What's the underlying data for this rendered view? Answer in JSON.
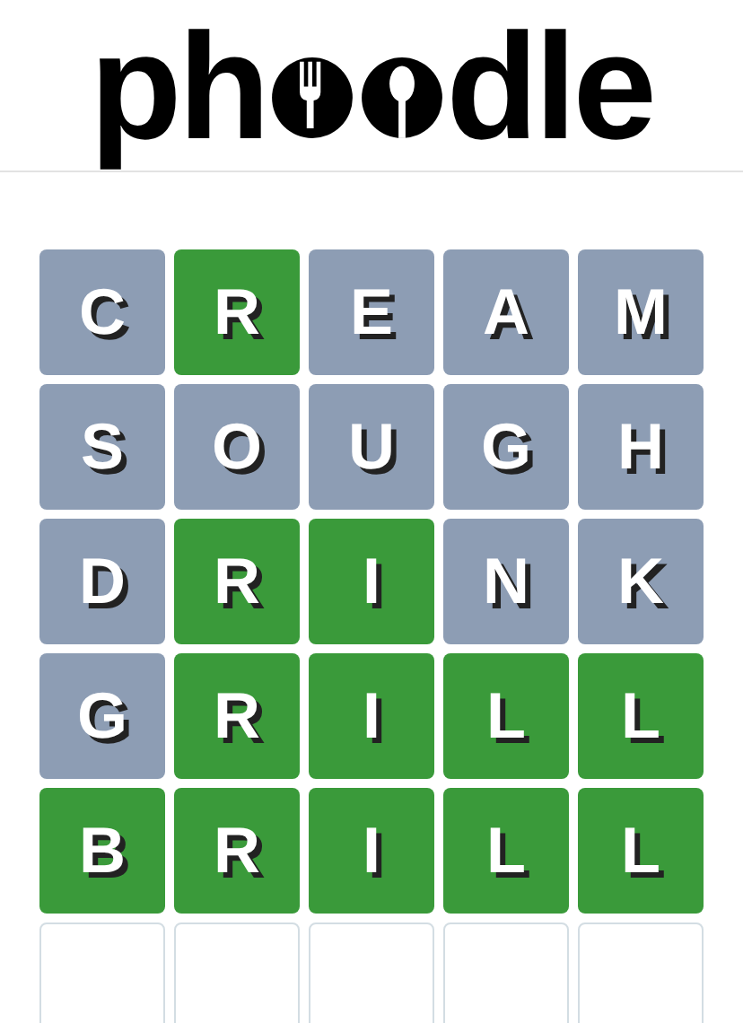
{
  "logo": {
    "text_before": "ph",
    "text_after": "dle"
  },
  "board": {
    "rows": [
      {
        "tiles": [
          {
            "letter": "C",
            "kind": "absent"
          },
          {
            "letter": "R",
            "kind": "correct"
          },
          {
            "letter": "E",
            "kind": "absent"
          },
          {
            "letter": "A",
            "kind": "absent"
          },
          {
            "letter": "M",
            "kind": "absent"
          }
        ]
      },
      {
        "tiles": [
          {
            "letter": "S",
            "kind": "absent"
          },
          {
            "letter": "O",
            "kind": "absent"
          },
          {
            "letter": "U",
            "kind": "absent"
          },
          {
            "letter": "G",
            "kind": "absent"
          },
          {
            "letter": "H",
            "kind": "absent"
          }
        ]
      },
      {
        "tiles": [
          {
            "letter": "D",
            "kind": "absent"
          },
          {
            "letter": "R",
            "kind": "correct"
          },
          {
            "letter": "I",
            "kind": "correct"
          },
          {
            "letter": "N",
            "kind": "absent"
          },
          {
            "letter": "K",
            "kind": "absent"
          }
        ]
      },
      {
        "tiles": [
          {
            "letter": "G",
            "kind": "absent"
          },
          {
            "letter": "R",
            "kind": "correct"
          },
          {
            "letter": "I",
            "kind": "correct"
          },
          {
            "letter": "L",
            "kind": "correct"
          },
          {
            "letter": "L",
            "kind": "correct"
          }
        ]
      },
      {
        "tiles": [
          {
            "letter": "B",
            "kind": "correct"
          },
          {
            "letter": "R",
            "kind": "correct"
          },
          {
            "letter": "I",
            "kind": "correct"
          },
          {
            "letter": "L",
            "kind": "correct"
          },
          {
            "letter": "L",
            "kind": "correct"
          }
        ]
      },
      {
        "tiles": [
          {
            "kind": "empty"
          },
          {
            "kind": "empty"
          },
          {
            "kind": "empty"
          },
          {
            "kind": "empty"
          },
          {
            "kind": "empty"
          }
        ]
      }
    ]
  }
}
